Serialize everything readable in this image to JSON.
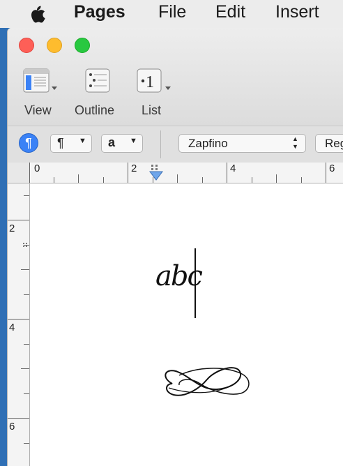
{
  "menubar": {
    "apple_icon": "apple-icon",
    "items": [
      "Pages",
      "File",
      "Edit",
      "Insert"
    ]
  },
  "toolbar": {
    "view_label": "View",
    "outline_label": "Outline",
    "list_label": "List",
    "list_glyph": "•1"
  },
  "format_bar": {
    "paragraph_glyph": "¶",
    "paragraph_style": "¶",
    "character_style": "a",
    "font_name": "Zapfino",
    "typeface": "Reg"
  },
  "ruler": {
    "horizontal_numbers": [
      "0",
      "2",
      "4",
      "6"
    ],
    "vertical_numbers": [
      "2",
      "4",
      "6"
    ]
  },
  "document": {
    "text": "abc"
  },
  "colors": {
    "close": "#fe5f57",
    "minimize": "#febc2e",
    "zoom": "#28c840",
    "accent": "#3b82f6",
    "desktop": "#2f6fb5"
  }
}
